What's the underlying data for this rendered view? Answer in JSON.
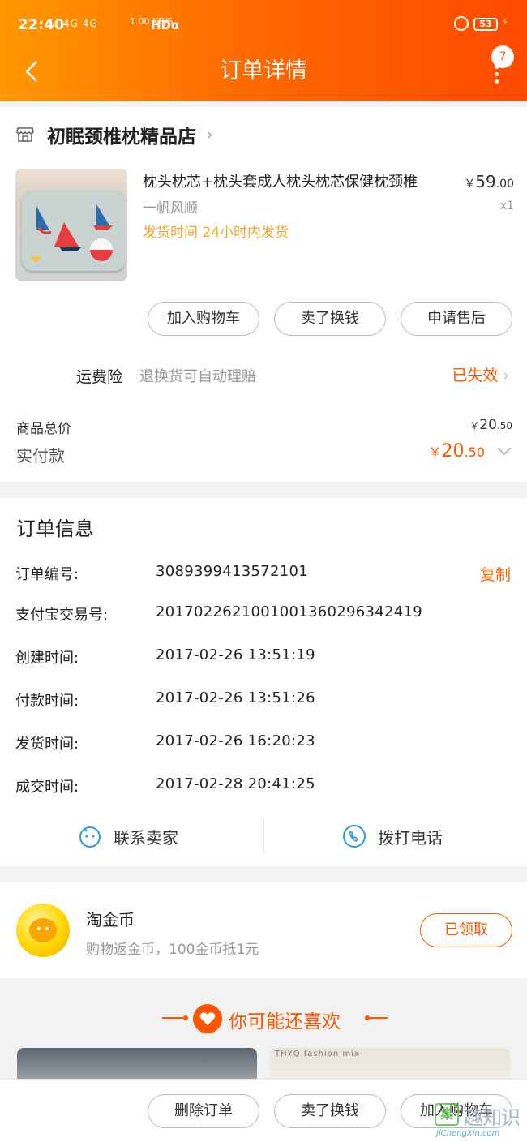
{
  "status_bar": {
    "time": "22:40",
    "network": "4G 4G",
    "speed": "1.00 KB/S",
    "hd": "HDα",
    "battery": "53"
  },
  "header": {
    "title": "订单详情",
    "badge_count": "7",
    "colors": {
      "gradient_start": "#ff9800",
      "gradient_end": "#ff4a00"
    }
  },
  "shop": {
    "name": "初眠颈椎枕精品店",
    "icon": "store-icon",
    "chevron": "›"
  },
  "product": {
    "title": "枕头枕芯+枕头套成人枕头枕芯保健枕颈椎",
    "sku": "一帆风顺",
    "shipping": "发货时间 24小时内发货",
    "price_currency": "￥",
    "price_int": "59",
    "price_dec": ".00",
    "qty": "x1"
  },
  "item_actions": [
    "加入购物车",
    "卖了换钱",
    "申请售后"
  ],
  "insurance": {
    "label": "运费险",
    "desc": "退换货可自动理赔",
    "status": "已失效",
    "chevron": "›"
  },
  "totals": {
    "goods_label": "商品总价",
    "goods_currency": "￥",
    "goods_int": "20",
    "goods_dec": ".50",
    "paid_label": "实付款",
    "paid_currency": "￥",
    "paid_int": "20",
    "paid_dec": ".50"
  },
  "order_info": {
    "title": "订单信息",
    "copy_label": "复制",
    "rows": [
      {
        "key": "订单编号:",
        "value": "3089399413572101"
      },
      {
        "key": "支付宝交易号:",
        "value": "2017022621001001360296342419"
      },
      {
        "key": "创建时间:",
        "value": "2017-02-26 13:51:19"
      },
      {
        "key": "付款时间:",
        "value": "2017-02-26 13:51:26"
      },
      {
        "key": "发货时间:",
        "value": "2017-02-26 16:20:23"
      },
      {
        "key": "成交时间:",
        "value": "2017-02-28 20:41:25"
      }
    ],
    "contact_seller": "联系卖家",
    "call_phone": "拨打电话"
  },
  "coins": {
    "title": "淘金币",
    "desc": "购物返金币，100金币抵1元",
    "button": "已领取"
  },
  "recommend": {
    "title": "你可能还喜欢",
    "item2_caption": "THYQ fashion mix"
  },
  "bottom_actions": [
    "删除订单",
    "卖了换钱",
    "加入购物车"
  ],
  "watermark": {
    "box": "集",
    "text": "趣知识",
    "url": "JiChengXin.com"
  }
}
